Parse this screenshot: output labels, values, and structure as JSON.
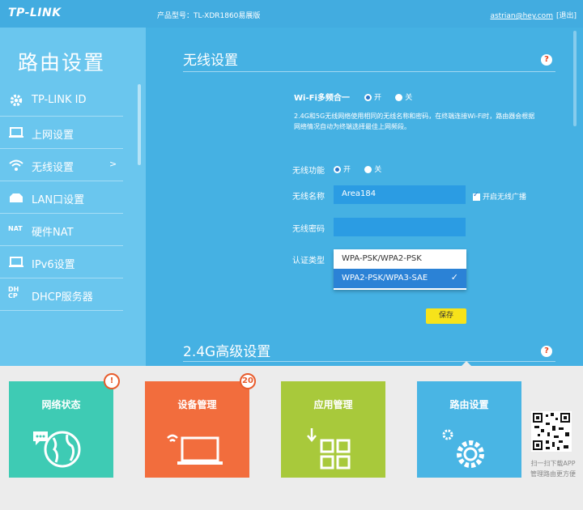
{
  "header": {
    "brand": "TP-LINK",
    "model": "产品型号：TL-XDR1860易展版",
    "email": "astrian@hey.com",
    "logout": "[退出]"
  },
  "sidebar": {
    "title": "路由设置",
    "items": [
      {
        "label": "TP-LINK ID",
        "icon": "gear-icon"
      },
      {
        "label": "上网设置",
        "icon": "laptop-icon"
      },
      {
        "label": "无线设置",
        "icon": "wifi-icon",
        "active": true,
        "arrow": ">"
      },
      {
        "label": "LAN口设置",
        "icon": "lan-icon"
      },
      {
        "label": "硬件NAT",
        "icon": "nat-icon",
        "icon_text": "NAT"
      },
      {
        "label": "IPv6设置",
        "icon": "laptop-icon"
      },
      {
        "label": "DHCP服务器",
        "icon": "dhcp-icon",
        "icon_text": "DH CP"
      }
    ]
  },
  "wireless": {
    "title": "无线设置",
    "help": "?",
    "multiband_label": "Wi-Fi多频合一",
    "on": "开",
    "off": "关",
    "desc": "2.4G和5G无线网络使用相同的无线名称和密码，在终端连接Wi-Fi时，路由器会根据网络情况自动为终端选择最佳上网频段。",
    "function_label": "无线功能",
    "name_label": "无线名称",
    "name_value": "Area184",
    "broadcast_label": "开启无线广播",
    "password_label": "无线密码",
    "password_value": "",
    "auth_label": "认证类型",
    "auth_options": [
      "WPA-PSK/WPA2-PSK",
      "WPA2-PSK/WPA3-SAE"
    ],
    "auth_selected": "WPA2-PSK/WPA3-SAE",
    "save": "保存"
  },
  "advanced": {
    "title": "2.4G高级设置",
    "help": "?"
  },
  "tiles": [
    {
      "label": "网络状态",
      "color": "#3ecbb4",
      "icon": "globe-icon",
      "badge": "!"
    },
    {
      "label": "设备管理",
      "color": "#f26d3d",
      "icon": "laptop-wifi-icon",
      "badge": "20"
    },
    {
      "label": "应用管理",
      "color": "#a8c93b",
      "icon": "apps-grid-icon"
    },
    {
      "label": "路由设置",
      "color": "#49b5e4",
      "icon": "settings-gears-icon",
      "active": true
    }
  ],
  "qr": {
    "line1": "扫一扫下载APP",
    "line2": "管理路由更方便"
  },
  "colors": {
    "main_bg": "#45b1e3",
    "sidebar_bg": "#6ac6ee",
    "save_button": "#f7e31a",
    "selected_option": "#2b82d6"
  }
}
